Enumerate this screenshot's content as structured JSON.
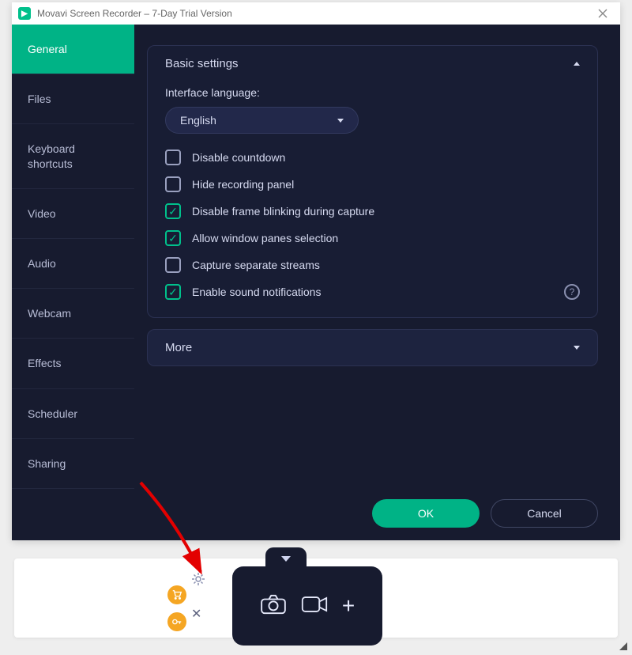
{
  "window": {
    "title": "Movavi Screen Recorder – 7-Day Trial Version",
    "app_icon_glyph": "▶"
  },
  "sidebar": {
    "items": [
      {
        "label": "General",
        "active": true
      },
      {
        "label": "Files"
      },
      {
        "label": "Keyboard shortcuts"
      },
      {
        "label": "Video"
      },
      {
        "label": "Audio"
      },
      {
        "label": "Webcam"
      },
      {
        "label": "Effects"
      },
      {
        "label": "Scheduler"
      },
      {
        "label": "Sharing"
      }
    ]
  },
  "panels": {
    "basic": {
      "title": "Basic settings",
      "language_label": "Interface language:",
      "language_value": "English",
      "checks": [
        {
          "label": "Disable countdown",
          "checked": false
        },
        {
          "label": "Hide recording panel",
          "checked": false
        },
        {
          "label": "Disable frame blinking during capture",
          "checked": true
        },
        {
          "label": "Allow window panes selection",
          "checked": true
        },
        {
          "label": "Capture separate streams",
          "checked": false
        },
        {
          "label": "Enable sound notifications",
          "checked": true,
          "help": true
        }
      ]
    },
    "more": {
      "title": "More"
    }
  },
  "buttons": {
    "ok": "OK",
    "cancel": "Cancel"
  },
  "colors": {
    "accent": "#00b386",
    "panel_bg": "#171b2f"
  }
}
